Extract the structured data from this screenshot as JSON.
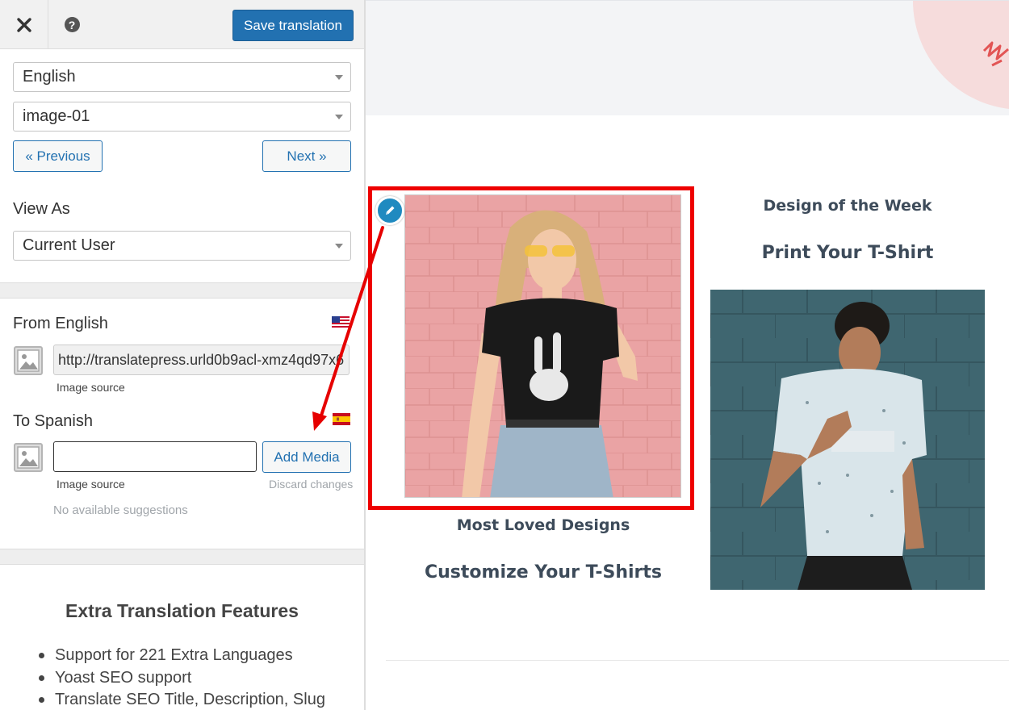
{
  "toolbar": {
    "close_icon": "close-icon",
    "help_icon": "help-icon",
    "help_glyph": "?",
    "save_label": "Save translation"
  },
  "selectors": {
    "language": "English",
    "string": "image-01"
  },
  "navigation": {
    "previous_label": "« Previous",
    "next_label": "Next »"
  },
  "view_as": {
    "label": "View As",
    "value": "Current User"
  },
  "from": {
    "label": "From English",
    "flag": "us-flag-icon",
    "source_value": "http://translatepress.urld0b9acl-xmz4qd97x6",
    "source_caption": "Image source"
  },
  "to": {
    "label": "To Spanish",
    "flag": "spain-flag-icon",
    "value": "",
    "add_media_label": "Add Media",
    "source_caption": "Image source",
    "discard_label": "Discard changes",
    "suggestions_text": "No available suggestions"
  },
  "extra_features": {
    "title": "Extra Translation Features",
    "items": [
      "Support for 221 Extra Languages",
      "Yoast SEO support",
      "Translate SEO Title, Description, Slug"
    ]
  },
  "preview": {
    "left_card": {
      "caption": "Most Loved Designs",
      "heading": "Customize Your T-Shirts"
    },
    "right_card": {
      "caption": "Design of the Week",
      "heading": "Print Your T-Shirt"
    }
  },
  "colors": {
    "accent": "#2271b1",
    "highlight_frame": "#ee0000",
    "edit_badge": "#1f8ac0"
  }
}
